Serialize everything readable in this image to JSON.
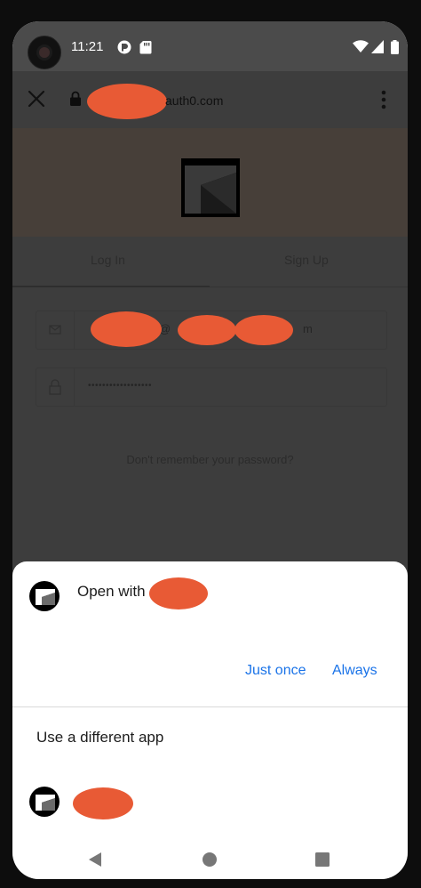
{
  "status_bar": {
    "time": "11:21",
    "icons": [
      "camera-cutout",
      "app-notification-icon",
      "sd-card-icon",
      "wifi-icon",
      "cell-signal-icon",
      "battery-icon"
    ]
  },
  "browser": {
    "close_icon": "close-icon",
    "lock_icon": "lock-icon",
    "url_suffix": "auth0.com",
    "menu_icon": "more-vert-icon"
  },
  "login_page": {
    "tabs": [
      {
        "label": "Log In",
        "active": true
      },
      {
        "label": "Sign Up",
        "active": false
      }
    ],
    "email_value_suffix": "m",
    "email_at": "@",
    "password_value": "••••••••••••••••••",
    "forgot_label": "Don't remember your password?"
  },
  "sheet": {
    "title_prefix": "Open with",
    "title_suffix": "",
    "just_once_label": "Just once",
    "always_label": "Always",
    "different_app_label": "Use a different app"
  },
  "nav": {
    "back_icon": "back-icon",
    "home_icon": "home-icon",
    "recents_icon": "recents-icon"
  },
  "colors": {
    "accent": "#1a73e8",
    "redaction": "#e85a35",
    "scrim": "#3d3d3d"
  }
}
